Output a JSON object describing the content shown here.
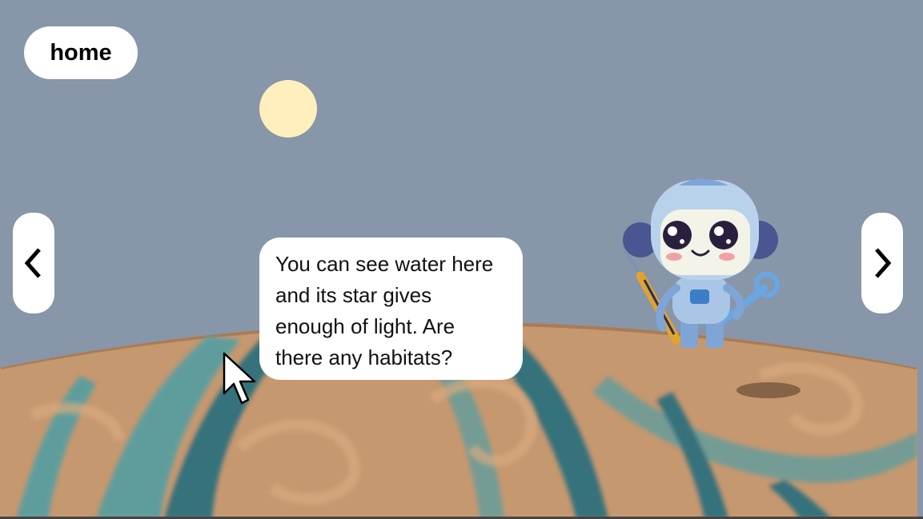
{
  "nav": {
    "home_label": "home",
    "prev_icon": "chevron-left-icon",
    "next_icon": "chevron-right-icon"
  },
  "dialog": {
    "text": "You can see water here and its star gives enough of light. Are there any habitats?"
  },
  "scene": {
    "sky_color": "#8796a9",
    "star_color": "#ffefbc",
    "planet_colors": [
      "#c69870",
      "#5a9ea0",
      "#2e6f7d"
    ],
    "character": "robot-mascot"
  }
}
